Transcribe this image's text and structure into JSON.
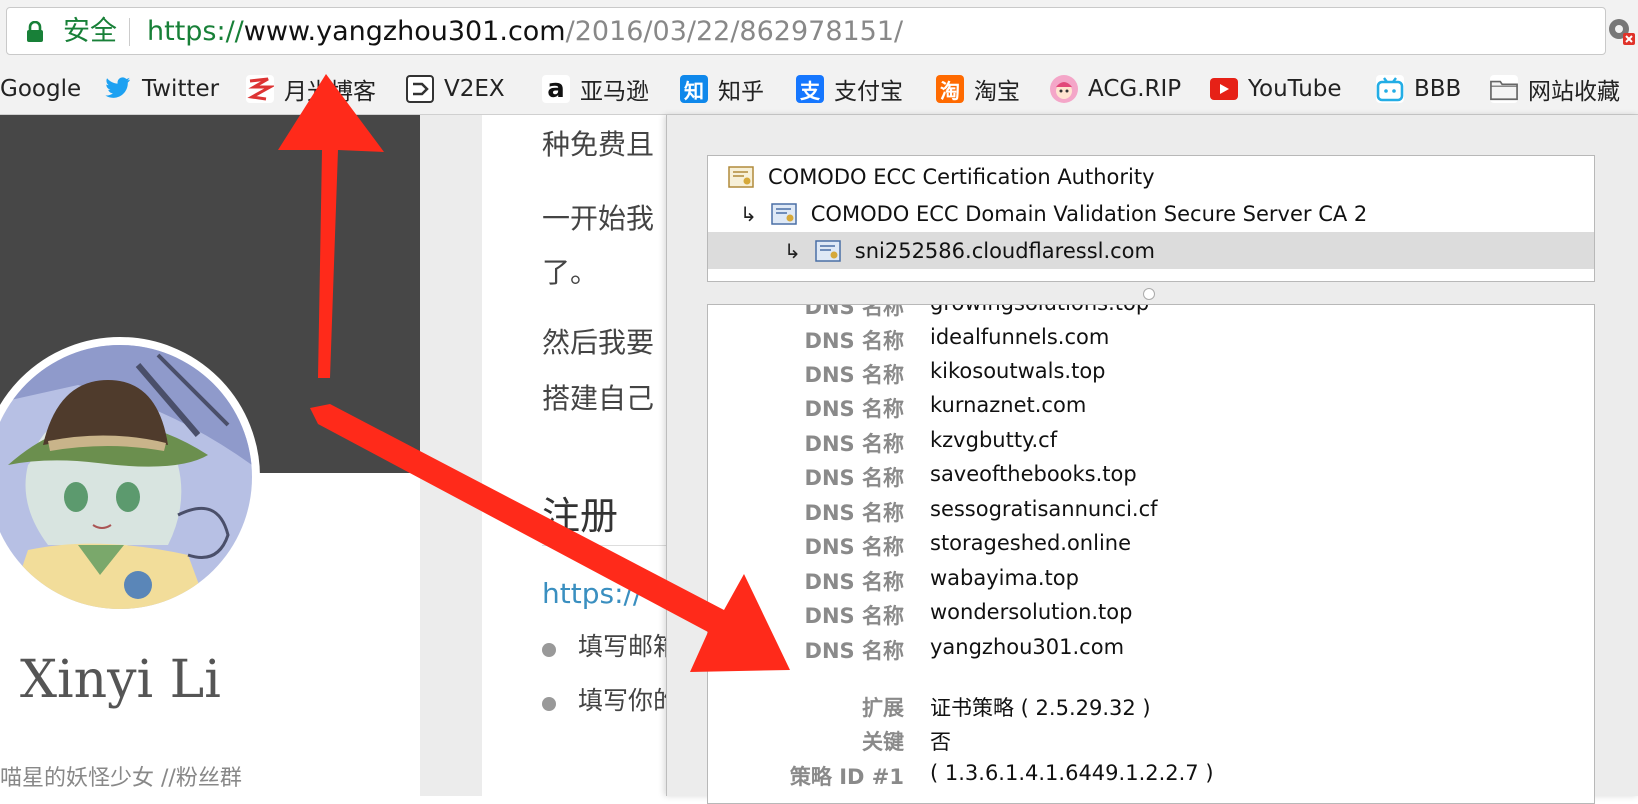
{
  "addressbar": {
    "secure_label": "安全",
    "url_scheme": "https://",
    "url_host": "www.yangzhou301.com",
    "url_path": "/2016/03/22/862978151/"
  },
  "bookmarks": [
    {
      "label": "Google",
      "icon": "google-icon"
    },
    {
      "label": "Twitter",
      "icon": "twitter-bird-icon"
    },
    {
      "label": "月光博客",
      "icon": "moon-blog-icon"
    },
    {
      "label": "V2EX",
      "icon": "v2ex-icon"
    },
    {
      "label": "亚马逊",
      "icon": "amazon-icon"
    },
    {
      "label": "知乎",
      "icon": "zhihu-icon"
    },
    {
      "label": "支付宝",
      "icon": "alipay-icon"
    },
    {
      "label": "淘宝",
      "icon": "taobao-icon"
    },
    {
      "label": "ACG.RIP",
      "icon": "acgrip-icon"
    },
    {
      "label": "YouTube",
      "icon": "youtube-icon"
    },
    {
      "label": "BBB",
      "icon": "bilibili-icon"
    },
    {
      "label": "网站收藏",
      "icon": "folder-icon"
    }
  ],
  "colors": {
    "secure_green": "#188038",
    "link_blue": "#3a8fc0",
    "annotation_red": "#ff2a1a"
  },
  "sidebar": {
    "author_name": "Xinyi Li",
    "author_desc": "喵星的妖怪少女 //粉丝群"
  },
  "content": {
    "paragraphs": [
      "种免费且",
      "一开始我",
      "了。",
      "然后我要",
      "搭建自己"
    ],
    "heading": "注册",
    "link_text": "https://",
    "list_items": [
      "填写邮箱",
      "填写你的"
    ]
  },
  "certificate": {
    "chain": [
      {
        "name": "COMODO ECC Certification Authority"
      },
      {
        "name": "COMODO ECC Domain Validation Secure Server CA 2"
      },
      {
        "name": "sni252586.cloudflaressl.com"
      }
    ],
    "dns_label": "DNS 名称",
    "dns_names": [
      "growingsolutions.top",
      "idealfunnels.com",
      "kikosoutwals.top",
      "kurnaznet.com",
      "kzvgbutty.cf",
      "saveofthebooks.top",
      "sessogratisannunci.cf",
      "storageshed.online",
      "wabayima.top",
      "wondersolution.top",
      "yangzhou301.com"
    ],
    "extension_label": "扩展",
    "extension_value": "证书策略 ( 2.5.29.32 )",
    "critical_label": "关键",
    "critical_value": "否",
    "policy_label": "策略 ID #1",
    "policy_value": "( 1.3.6.1.4.1.6449.1.2.2.7 )"
  }
}
